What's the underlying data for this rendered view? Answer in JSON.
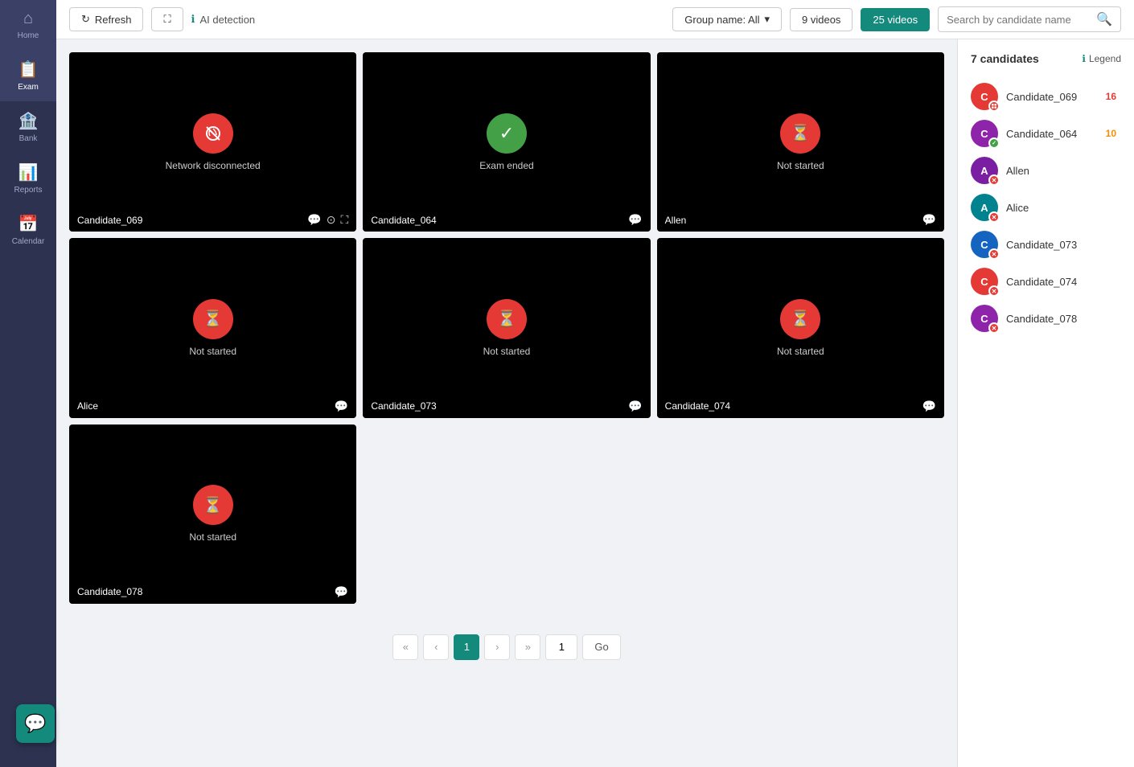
{
  "sidebar": {
    "items": [
      {
        "id": "home",
        "label": "Home",
        "icon": "⌂",
        "active": false
      },
      {
        "id": "exam",
        "label": "Exam",
        "icon": "📋",
        "active": true
      },
      {
        "id": "bank",
        "label": "Bank",
        "icon": "🏦",
        "active": false
      },
      {
        "id": "reports",
        "label": "Reports",
        "icon": "📊",
        "active": false
      },
      {
        "id": "calendar",
        "label": "Calendar",
        "icon": "📅",
        "active": false
      }
    ]
  },
  "toolbar": {
    "refresh_label": "Refresh",
    "ai_detection_label": "AI detection",
    "group_name_label": "Group name: All",
    "videos_9_label": "9 videos",
    "videos_25_label": "25 videos",
    "search_placeholder": "Search by candidate name"
  },
  "grid": {
    "cards": [
      {
        "id": "c069",
        "name": "Candidate_069",
        "status": "Network disconnected",
        "status_type": "network",
        "show_icons": true
      },
      {
        "id": "c064",
        "name": "Candidate_064",
        "status": "Exam ended",
        "status_type": "ended",
        "show_icons": false
      },
      {
        "id": "allen",
        "name": "Allen",
        "status": "Not started",
        "status_type": "not_started",
        "show_icons": false
      },
      {
        "id": "alice",
        "name": "Alice",
        "status": "Not started",
        "status_type": "not_started",
        "show_icons": false
      },
      {
        "id": "c073",
        "name": "Candidate_073",
        "status": "Not started",
        "status_type": "not_started",
        "show_icons": false
      },
      {
        "id": "c074",
        "name": "Candidate_074",
        "status": "Not started",
        "status_type": "not_started",
        "show_icons": false
      },
      {
        "id": "c078",
        "name": "Candidate_078",
        "status": "Not started",
        "status_type": "not_started",
        "show_icons": false
      }
    ]
  },
  "pagination": {
    "current": "1",
    "page_input": "1",
    "go_label": "Go"
  },
  "right_panel": {
    "candidates_count": "7 candidates",
    "legend_label": "Legend",
    "candidates": [
      {
        "id": "c069",
        "name": "Candidate_069",
        "avatar_color": "#e53935",
        "avatar_letter": "C",
        "badge": "16",
        "badge_type": "red",
        "badge_icon": "expand"
      },
      {
        "id": "c064",
        "name": "Candidate_064",
        "avatar_color": "#8e24aa",
        "avatar_letter": "C",
        "badge": "10",
        "badge_type": "orange",
        "badge_icon": "check"
      },
      {
        "id": "allen",
        "name": "Allen",
        "avatar_color": "#7b1fa2",
        "avatar_letter": "A",
        "badge": "",
        "badge_type": "none"
      },
      {
        "id": "alice",
        "name": "Alice",
        "avatar_color": "#00838f",
        "avatar_letter": "A",
        "badge": "",
        "badge_type": "none"
      },
      {
        "id": "c073",
        "name": "Candidate_073",
        "avatar_color": "#1565c0",
        "avatar_letter": "C",
        "badge": "",
        "badge_type": "none"
      },
      {
        "id": "c074",
        "name": "Candidate_074",
        "avatar_color": "#e53935",
        "avatar_letter": "C",
        "badge": "",
        "badge_type": "none"
      },
      {
        "id": "c078",
        "name": "Candidate_078",
        "avatar_color": "#8e24aa",
        "avatar_letter": "C",
        "badge": "",
        "badge_type": "none"
      }
    ]
  },
  "chat": {
    "icon": "💬"
  }
}
